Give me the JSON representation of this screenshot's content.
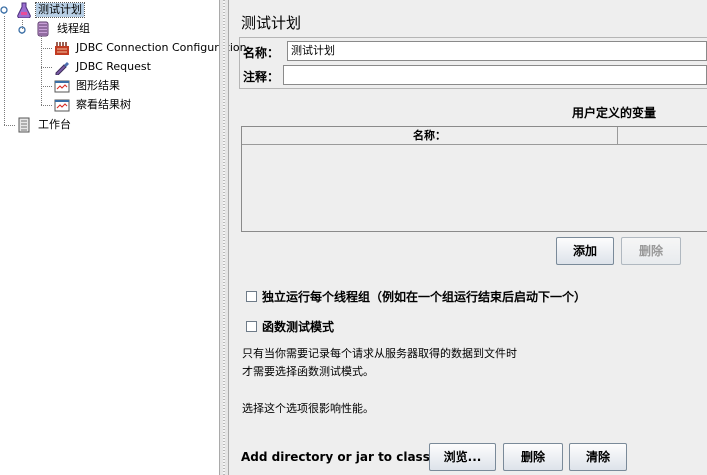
{
  "tree": {
    "items": [
      {
        "label": "测试计划",
        "icon": "test-plan-icon"
      },
      {
        "label": "线程组",
        "icon": "thread-group-icon"
      },
      {
        "label": "JDBC Connection Configuration",
        "icon": "jdbc-config-icon"
      },
      {
        "label": "JDBC Request",
        "icon": "jdbc-request-icon"
      },
      {
        "label": "图形结果",
        "icon": "graph-results-icon"
      },
      {
        "label": "察看结果树",
        "icon": "results-tree-icon"
      },
      {
        "label": "工作台",
        "icon": "workbench-icon"
      }
    ]
  },
  "panel": {
    "title": "测试计划",
    "name_label": "名称：",
    "name_value": "测试计划",
    "comment_label": "注释：",
    "comment_value": "",
    "vars_title": "用户定义的变量",
    "vars_column_name": "名称：",
    "vars_column_value": "",
    "add_button": "添加",
    "delete_button": "删除",
    "checkbox_serialize": "独立运行每个线程组（例如在一个组运行结束后启动下一个）",
    "checkbox_functional": "函数测试模式",
    "note_line1": "只有当你需要记录每个请求从服务器取得的数据到文件时",
    "note_line2": "才需要选择函数测试模式。",
    "note_line3": "选择这个选项很影响性能。",
    "classpath_label": "Add directory or jar to classpath",
    "browse_button": "浏览...",
    "classpath_delete_button": "删除",
    "clear_button": "清除"
  }
}
